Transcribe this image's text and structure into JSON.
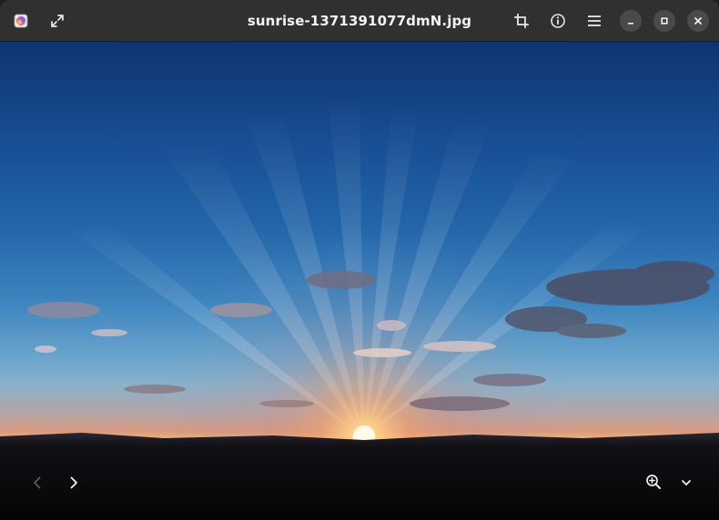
{
  "window": {
    "title": "sunrise-1371391077dmN.jpg"
  },
  "header": {
    "app_icon": "image-viewer-app-icon",
    "fullscreen_icon": "fullscreen-icon",
    "crop_icon": "crop-icon",
    "properties_icon": "info-icon",
    "menu_icon": "hamburger-menu-icon",
    "minimize_icon": "minimize-icon",
    "maximize_icon": "maximize-icon",
    "close_icon": "close-icon"
  },
  "viewer": {
    "image_subject": "sunrise over horizon",
    "previous_icon": "chevron-left-icon",
    "next_icon": "chevron-right-icon",
    "zoom_icon": "zoom-in-icon",
    "zoom_menu_icon": "chevron-down-icon"
  },
  "colors": {
    "headerbar": "#303030",
    "title_text": "#f2f2f2",
    "window_button_bg": "#4a4a4a",
    "icon_fg": "#e6e6e6",
    "disabled_icon_fg": "#5a5a5a"
  }
}
